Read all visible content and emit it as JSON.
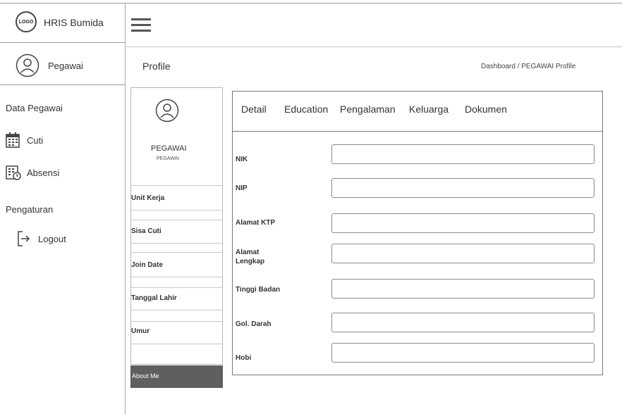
{
  "app": {
    "logo_text": "LOGO",
    "title": "HRIS Bumida"
  },
  "sidebar": {
    "user_label": "Pegawai",
    "section_data": "Data Pegawai",
    "items": [
      {
        "label": "Cuti",
        "icon": "calendar-icon"
      },
      {
        "label": "Absensi",
        "icon": "attendance-icon"
      }
    ],
    "section_settings": "Pengaturan",
    "logout_label": "Logout"
  },
  "header": {
    "menu_icon": "hamburger-icon"
  },
  "page": {
    "title": "Profile",
    "breadcrumb": "Dashboard / PEGAWAI Profile"
  },
  "profile_card": {
    "name": "PEGAWAI",
    "role": "PEGAWAI",
    "info_labels": [
      "Unit Kerja",
      "Sisa Cuti",
      "Join Date",
      "Tanggal Lahir",
      "Umur"
    ],
    "about_button": "About Me"
  },
  "tabs": [
    "Detail",
    "Education",
    "Pengalaman",
    "Keluarga",
    "Dokumen"
  ],
  "form": {
    "fields": [
      {
        "label": "NIK",
        "value": ""
      },
      {
        "label": "NIP",
        "value": ""
      },
      {
        "label": "Alamat KTP",
        "value": ""
      },
      {
        "label": "Alamat Lengkap",
        "value": ""
      },
      {
        "label": "Tinggi Badan",
        "value": ""
      },
      {
        "label": "Gol. Darah",
        "value": ""
      },
      {
        "label": "Hobi",
        "value": ""
      }
    ]
  }
}
